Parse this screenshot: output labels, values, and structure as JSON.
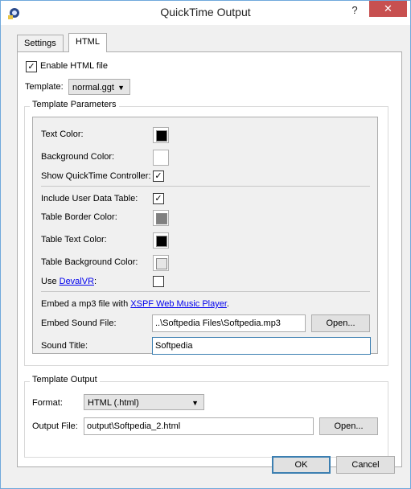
{
  "window": {
    "title": "QuickTime Output",
    "help_label": "?",
    "close_label": "✕",
    "app_icon": "quicktime-output-icon"
  },
  "tabs": [
    {
      "label": "Settings",
      "active": false
    },
    {
      "label": "HTML",
      "active": true
    }
  ],
  "html_tab": {
    "enable_html": {
      "label": "Enable HTML file",
      "checked": true,
      "mark": "✓"
    },
    "template": {
      "label": "Template:",
      "value": "normal.ggt",
      "arrow": "▼"
    },
    "template_parameters": {
      "title": "Template Parameters",
      "text_color": {
        "label": "Text Color:",
        "color": "#000000"
      },
      "background_color": {
        "label": "Background Color:",
        "color": "#ffffff"
      },
      "show_controller": {
        "label": "Show QuickTime Controller:",
        "checked": true,
        "mark": "✓"
      },
      "include_user_data": {
        "label": "Include User Data Table:",
        "checked": true,
        "mark": "✓"
      },
      "table_border_color": {
        "label": "Table Border Color:",
        "color": "#808080"
      },
      "table_text_color": {
        "label": "Table Text Color:",
        "color": "#000000"
      },
      "table_background_color": {
        "label": "Table Background Color:",
        "color": "#e6e6e6"
      },
      "use_devalvr": {
        "prefix": "Use ",
        "link": "DevalVR",
        "suffix": ":",
        "checked": false
      },
      "embed_mp3": {
        "prefix": "Embed a mp3 file with ",
        "link": "XSPF Web Music Player",
        "suffix": "."
      },
      "embed_sound_file": {
        "label": "Embed Sound File:",
        "value": "..\\Softpedia Files\\Softpedia.mp3",
        "button": "Open..."
      },
      "sound_title": {
        "label": "Sound Title:",
        "value": "Softpedia"
      }
    },
    "template_output": {
      "title": "Template Output",
      "format": {
        "label": "Format:",
        "value": "HTML (.html)",
        "arrow": "▼"
      },
      "output_file": {
        "label": "Output File:",
        "value": "output\\Softpedia_2.html",
        "button": "Open..."
      }
    }
  },
  "footer": {
    "ok_label": "OK",
    "cancel_label": "Cancel"
  },
  "colors": {
    "accent": "#3c7fb1",
    "close_button": "#c75050",
    "link": "#0000ee"
  }
}
